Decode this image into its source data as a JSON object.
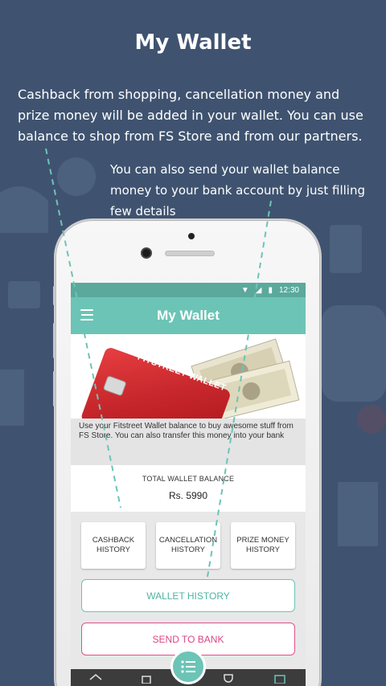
{
  "promo": {
    "title": "My Wallet",
    "text1": "Cashback from shopping, cancellation money and prize money will be added in your wallet. You can use balance to shop from FS Store and from our partners.",
    "text2": "You can also send your wallet balance money to your bank account by just filling few details"
  },
  "status_bar": {
    "time": "12:30"
  },
  "app_bar": {
    "title": "My Wallet"
  },
  "banner": {
    "card_text": "FITSTREET WALLET"
  },
  "description": "Use your Fitstreet Wallet balance to buy awesome stuff from FS Store. You can also transfer this money into your bank",
  "balance": {
    "label": "TOTAL WALLET BALANCE",
    "value": "Rs. 5990"
  },
  "tiles": [
    {
      "label": "CASHBACK HISTORY"
    },
    {
      "label": "CANCELLATION HISTORY"
    },
    {
      "label": "PRIZE MONEY HISTORY"
    }
  ],
  "buttons": {
    "wallet_history": "WALLET HISTORY",
    "send_to_bank": "SEND TO BANK"
  },
  "bottom_nav": {
    "icons": [
      "home-icon",
      "store-icon",
      "list-icon",
      "trophy-icon",
      "wallet-icon"
    ]
  },
  "colors": {
    "background": "#3f5370",
    "accent": "#6cc4b6",
    "pink": "#e0508a"
  }
}
